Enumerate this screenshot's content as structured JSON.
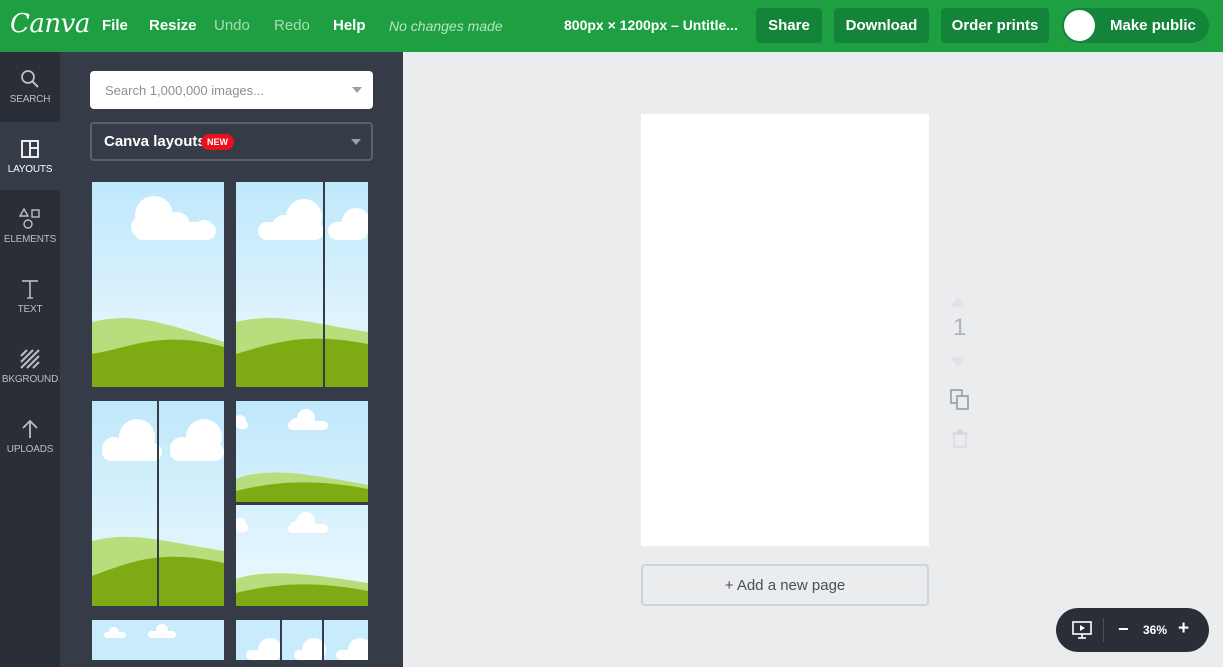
{
  "header": {
    "logo": "Canva",
    "menu": {
      "file": "File",
      "resize": "Resize",
      "undo": "Undo",
      "redo": "Redo",
      "help": "Help"
    },
    "status": "No changes made",
    "doc_title": "800px × 1200px – Untitle...",
    "share": "Share",
    "download": "Download",
    "order_prints": "Order prints",
    "make_public": "Make public"
  },
  "sidebar": {
    "items": [
      {
        "label": "SEARCH",
        "icon": "search-icon"
      },
      {
        "label": "LAYOUTS",
        "icon": "layouts-icon"
      },
      {
        "label": "ELEMENTS",
        "icon": "elements-icon"
      },
      {
        "label": "TEXT",
        "icon": "text-icon"
      },
      {
        "label": "BKGROUND",
        "icon": "background-icon"
      },
      {
        "label": "UPLOADS",
        "icon": "uploads-icon"
      }
    ]
  },
  "panel": {
    "search_placeholder": "Search 1,000,000 images...",
    "dropdown_label": "Canva layouts",
    "badge": "NEW"
  },
  "canvas": {
    "page_number": "1",
    "add_page": "+ Add a new page"
  },
  "zoom": {
    "level": "36%",
    "minus": "−",
    "plus": "+"
  },
  "colors": {
    "brand_green": "#1ea042",
    "button_green": "#13843a",
    "sidebar_dark": "#2a2f37",
    "panel_dark": "#363c47",
    "badge_red": "#e8111d"
  }
}
